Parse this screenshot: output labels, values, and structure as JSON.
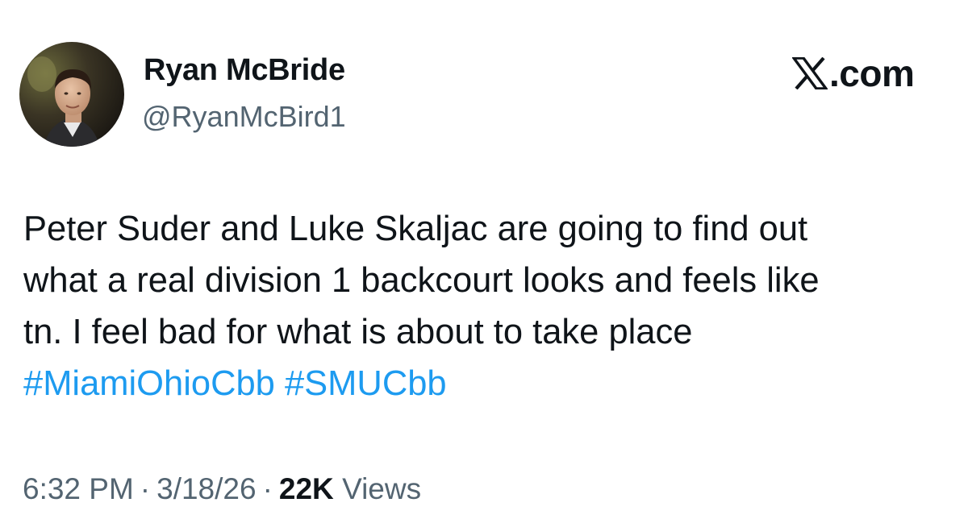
{
  "author": {
    "display_name": "Ryan McBride",
    "handle": "@RyanMcBird1",
    "avatar_icon": "profile-photo-avatar"
  },
  "brand": {
    "logo_icon": "x-logo-icon",
    "domain_text": ".com"
  },
  "tweet": {
    "lines": [
      "Peter Suder and Luke Skaljac are going to find out",
      "what a real division 1 backcourt looks and feels like",
      "tn. I feel bad for what is about to take place"
    ],
    "hashtags": [
      "#MiamiOhioCbb",
      "#SMUCbb"
    ]
  },
  "meta": {
    "time": "6:32 PM",
    "separator": "·",
    "date": "3/18/26",
    "views_count": "22K",
    "views_label": "Views"
  },
  "colors": {
    "text": "#0f1419",
    "secondary": "#536471",
    "link": "#1d9bf0",
    "background": "#ffffff"
  }
}
